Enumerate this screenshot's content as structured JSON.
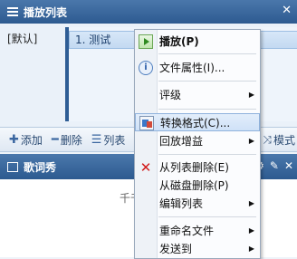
{
  "playlist": {
    "title": "播放列表",
    "close": "✕",
    "default_group": "[默认]",
    "items": [
      {
        "label": "1. 测试"
      }
    ]
  },
  "toolbar": {
    "add": "添加",
    "delete": "删除",
    "list": "列表",
    "mode": "模式"
  },
  "lyrics": {
    "title": "歌词秀",
    "partial_text": "千千"
  },
  "context_menu": {
    "items": [
      {
        "label": "播放(P)",
        "icon": "play-icon",
        "bold": true
      },
      {
        "label": "文件属性(I)...",
        "icon": "info-icon"
      },
      {
        "label": "评级",
        "submenu": true
      },
      {
        "label": "转换格式(C)...",
        "icon": "convert-icon",
        "highlighted": true
      },
      {
        "label": "回放增益",
        "submenu": true
      },
      {
        "label": "从列表删除(E)",
        "icon": "delete-icon"
      },
      {
        "label": "从磁盘删除(P)"
      },
      {
        "label": "编辑列表",
        "submenu": true
      },
      {
        "label": "重命名文件",
        "submenu": true
      },
      {
        "label": "发送到",
        "submenu": true
      }
    ]
  }
}
